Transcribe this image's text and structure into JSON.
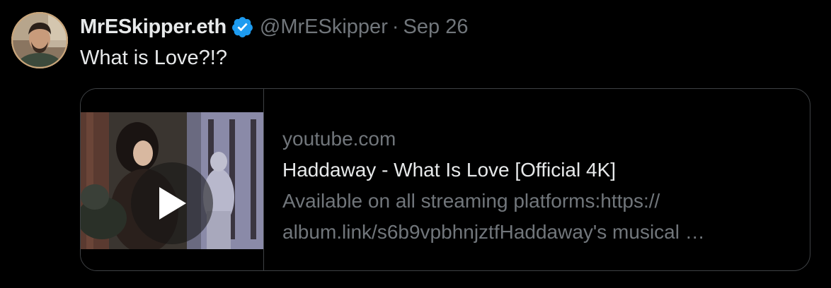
{
  "tweet": {
    "author": {
      "display_name": "MrESkipper.eth",
      "handle": "@MrESkipper",
      "verified": true,
      "avatar_icon": "profile-avatar"
    },
    "separator": "·",
    "date": "Sep 26",
    "text": "What is Love?!?",
    "card": {
      "domain": "youtube.com",
      "title": "Haddaway - What Is Love [Official 4K]",
      "description_line1": "Available on all streaming platforms:https://",
      "description_line2": "album.link/s6b9vpbhnjztfHaddaway's musical …",
      "thumbnail_icon": "video-thumbnail",
      "play_icon": "play-icon"
    }
  },
  "colors": {
    "background": "#000000",
    "text_primary": "#e7e9ea",
    "text_secondary": "#71767b",
    "border": "#3e4144",
    "verified_blue": "#1d9bf0"
  }
}
